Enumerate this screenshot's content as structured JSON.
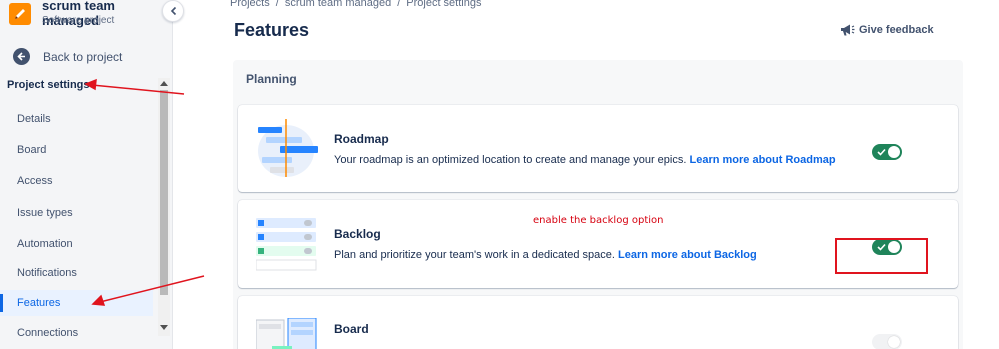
{
  "project": {
    "name": "scrum team managed",
    "type": "Software project"
  },
  "nav": {
    "back_label": "Back to project",
    "section_title": "Project settings",
    "items": [
      {
        "label": "Details"
      },
      {
        "label": "Board"
      },
      {
        "label": "Access"
      },
      {
        "label": "Issue types"
      },
      {
        "label": "Automation"
      },
      {
        "label": "Notifications"
      },
      {
        "label": "Features",
        "active": true
      },
      {
        "label": "Connections"
      }
    ]
  },
  "breadcrumb": [
    "Projects",
    "scrum team managed",
    "Project settings"
  ],
  "breadcrumb_sep": "/",
  "page": {
    "title": "Features",
    "feedback_label": "Give feedback",
    "section_title": "Planning"
  },
  "features": [
    {
      "title": "Roadmap",
      "description": "Your roadmap is an optimized location to create and manage your epics.",
      "link": "Learn more about Roadmap",
      "enabled": true
    },
    {
      "title": "Backlog",
      "description": "Plan and prioritize your team's work in a dedicated space.",
      "link": "Learn more about Backlog",
      "enabled": true
    },
    {
      "title": "Board",
      "enabled": false
    }
  ],
  "annotation": {
    "text": "enable the backlog option",
    "color": "#d6000f"
  },
  "colors": {
    "accent": "#0c66e4",
    "toggle_on": "#1f845a",
    "project_icon": "#ff8b00"
  }
}
